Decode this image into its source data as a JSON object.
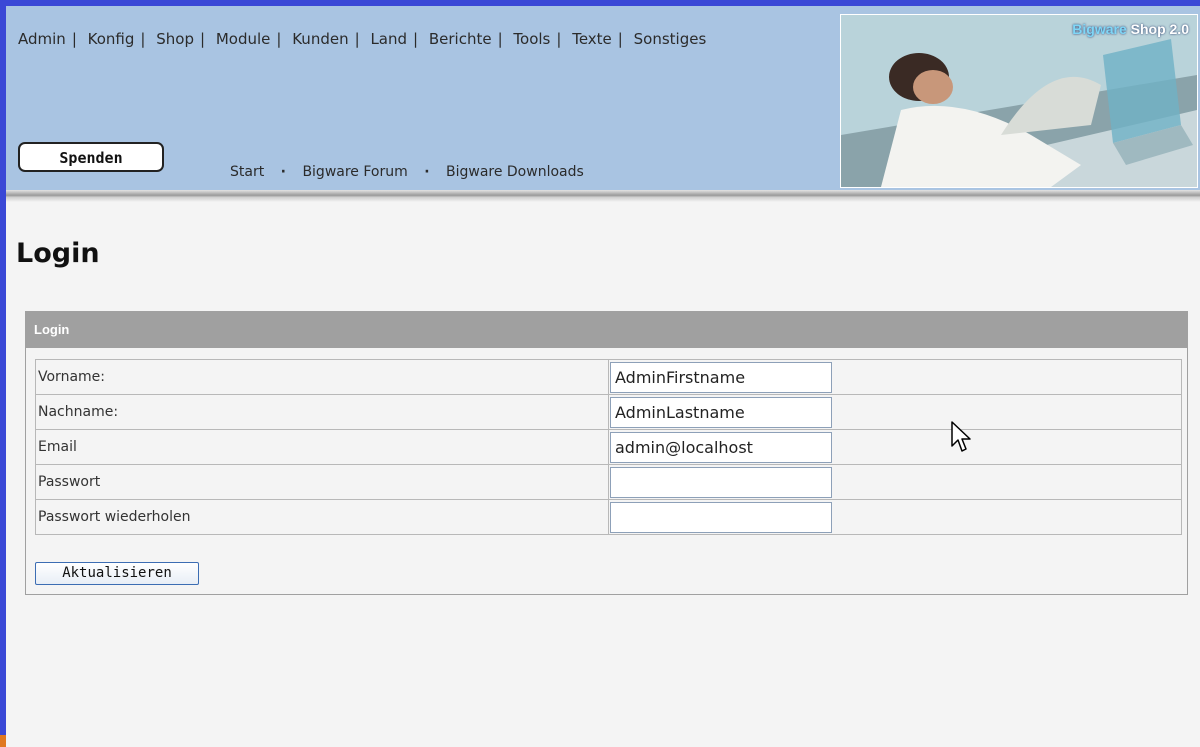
{
  "topnav": {
    "items": [
      "Admin",
      "Konfig",
      "Shop",
      "Module",
      "Kunden",
      "Land",
      "Berichte",
      "Tools",
      "Texte",
      "Sonstiges"
    ]
  },
  "header": {
    "donate_label": "Spenden",
    "subnav": [
      "Start",
      "Bigware Forum",
      "Bigware Downloads"
    ],
    "banner_brand": "Bigware",
    "banner_title": "Shop 2.0"
  },
  "main": {
    "title": "Login",
    "panel_title": "Login",
    "fields": [
      {
        "label": "Vorname:",
        "value": "AdminFirstname"
      },
      {
        "label": "Nachname:",
        "value": "AdminLastname"
      },
      {
        "label": "Email",
        "value": "admin@localhost"
      },
      {
        "label": "Passwort",
        "value": ""
      },
      {
        "label": "Passwort wiederholen",
        "value": ""
      }
    ],
    "submit_label": "Aktualisieren"
  },
  "icons": {
    "cursor": "mouse-pointer-icon"
  },
  "colors": {
    "header_bg": "#a9c4e2",
    "panel_head": "#a0a0a0",
    "frame": "#3a48d6"
  }
}
